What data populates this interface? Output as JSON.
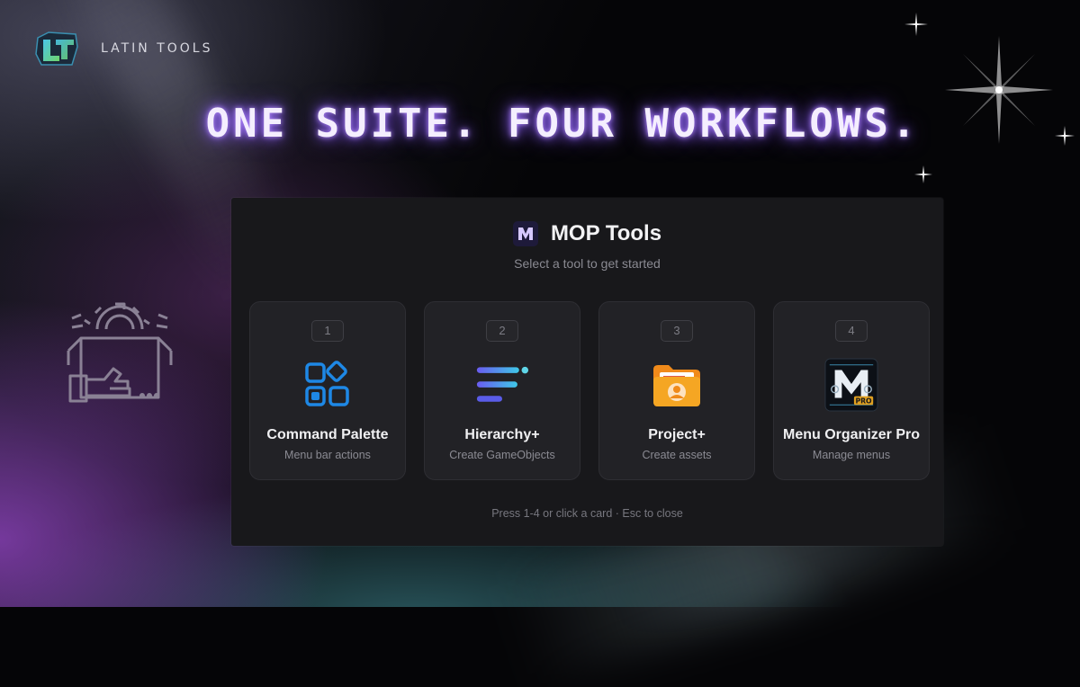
{
  "brand": {
    "name": "LATIN TOOLS",
    "logo_letters": "LT"
  },
  "headline": "ONE SUITE. FOUR WORKFLOWS.",
  "panel": {
    "title": "MOP Tools",
    "subtitle": "Select a tool to get started",
    "cards": [
      {
        "key": "1",
        "title": "Command Palette",
        "subtitle": "Menu bar actions",
        "icon": "grid-icon"
      },
      {
        "key": "2",
        "title": "Hierarchy+",
        "subtitle": "Create GameObjects",
        "icon": "hierarchy-icon"
      },
      {
        "key": "3",
        "title": "Project+",
        "subtitle": "Create assets",
        "icon": "folder-user-icon"
      },
      {
        "key": "4",
        "title": "Menu Organizer Pro",
        "subtitle": "Manage menus",
        "icon": "menu-organizer-logo-icon",
        "badge": "PRO"
      }
    ],
    "hint": "Press 1-4 or click a card · Esc to close"
  },
  "colors": {
    "accent_blue": "#1e88e5",
    "headline_glow": "#8a5cff",
    "panel_bg": "#18181b",
    "card_bg": "#222226",
    "folder_orange": "#f5a623"
  }
}
